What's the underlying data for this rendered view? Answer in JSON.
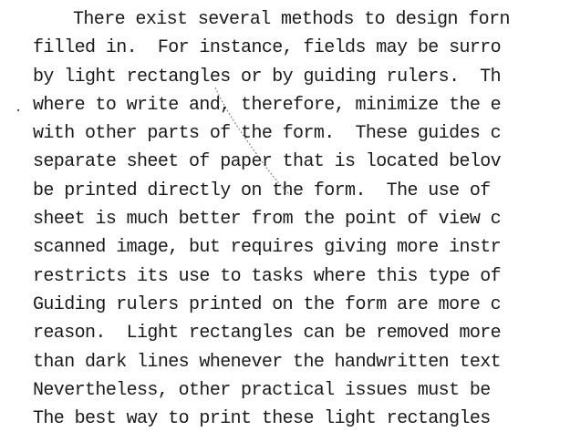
{
  "document": {
    "lines": [
      "There exist several methods to design forn",
      "filled in.  For instance, fields may be surro",
      "by light rectangles or by guiding rulers.  Th",
      "where to write and, therefore, minimize the e",
      "with other parts of the form.  These guides c",
      "separate sheet of paper that is located belov",
      "be printed directly on the form.  The use of",
      "sheet is much better from the point of view c",
      "scanned image, but requires giving more instr",
      "restricts its use to tasks where this type of",
      "Guiding rulers printed on the form are more c",
      "reason.  Light rectangles can be removed more",
      "than dark lines whenever the handwritten text",
      "Nevertheless, other practical issues must be",
      "The best way to print these light rectangles"
    ]
  }
}
